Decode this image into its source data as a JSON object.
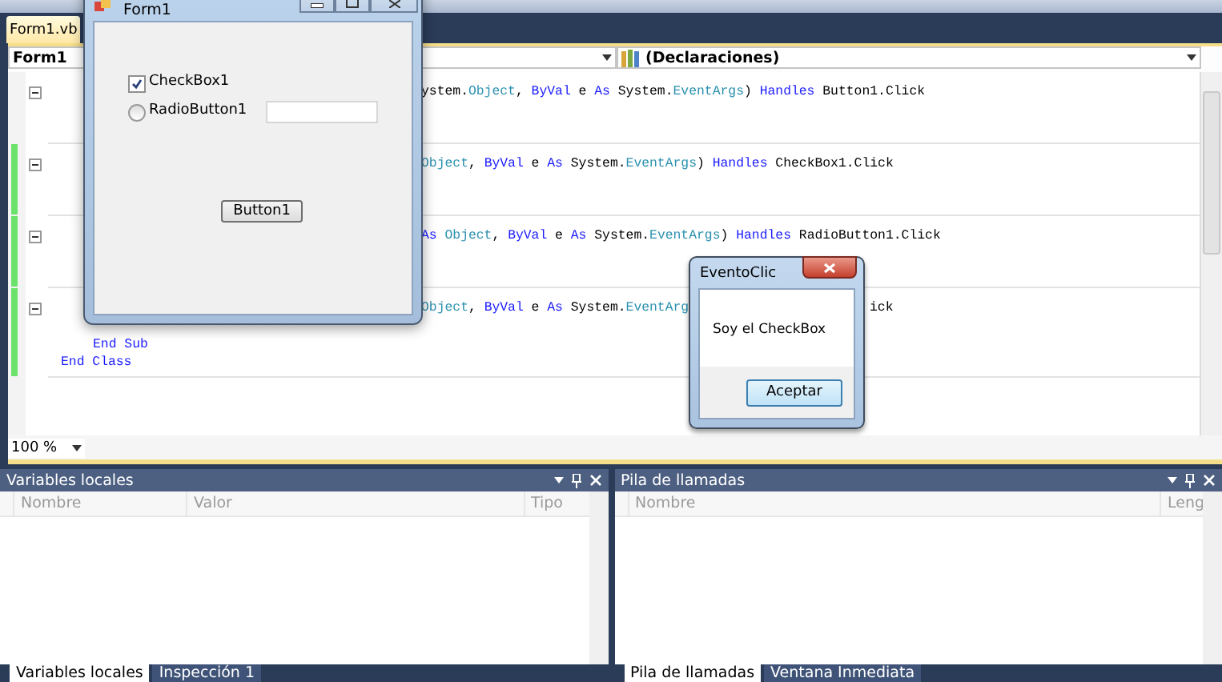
{
  "ide": {
    "document_tabs": [
      {
        "label": "Form1.vb",
        "selected": true
      }
    ],
    "class_combo": "Form1",
    "member_combo": "(Declaraciones)",
    "code_blocks": [
      {
        "modified": false,
        "signature": [
          [
            {
              "text": "ystem.",
              "kind": "plain"
            },
            {
              "text": "Object",
              "kind": "type"
            },
            {
              "text": ", ",
              "kind": "plain"
            },
            {
              "text": "ByVal",
              "kind": "keyword"
            },
            {
              "text": " e ",
              "kind": "plain"
            },
            {
              "text": "As",
              "kind": "keyword"
            },
            {
              "text": " System.",
              "kind": "plain"
            },
            {
              "text": "EventArgs",
              "kind": "type"
            },
            {
              "text": ") ",
              "kind": "plain"
            },
            {
              "text": "Handles",
              "kind": "keyword"
            },
            {
              "text": " Button1.Click",
              "kind": "plain"
            }
          ]
        ]
      },
      {
        "modified": true,
        "signature": [
          [
            {
              "text": "Object",
              "kind": "type"
            },
            {
              "text": ", ",
              "kind": "plain"
            },
            {
              "text": "ByVal",
              "kind": "keyword"
            },
            {
              "text": " e ",
              "kind": "plain"
            },
            {
              "text": "As",
              "kind": "keyword"
            },
            {
              "text": " System.",
              "kind": "plain"
            },
            {
              "text": "EventArgs",
              "kind": "type"
            },
            {
              "text": ") ",
              "kind": "plain"
            },
            {
              "text": "Handles",
              "kind": "keyword"
            },
            {
              "text": " CheckBox1.Click",
              "kind": "plain"
            }
          ]
        ]
      },
      {
        "modified": true,
        "signature": [
          [
            {
              "text": "As",
              "kind": "keyword"
            },
            {
              "text": " Object",
              "kind": "type"
            },
            {
              "text": ", ",
              "kind": "plain"
            },
            {
              "text": "ByVal",
              "kind": "keyword"
            },
            {
              "text": " e ",
              "kind": "plain"
            },
            {
              "text": "As",
              "kind": "keyword"
            },
            {
              "text": " System.",
              "kind": "plain"
            },
            {
              "text": "EventArgs",
              "kind": "type"
            },
            {
              "text": ") ",
              "kind": "plain"
            },
            {
              "text": "Handles",
              "kind": "keyword"
            },
            {
              "text": " RadioButton1.Click",
              "kind": "plain"
            }
          ]
        ]
      },
      {
        "modified": true,
        "signature": [
          [
            {
              "text": "Object",
              "kind": "type"
            },
            {
              "text": ", ",
              "kind": "plain"
            },
            {
              "text": "ByVal",
              "kind": "keyword"
            },
            {
              "text": " e ",
              "kind": "plain"
            },
            {
              "text": "As",
              "kind": "keyword"
            },
            {
              "text": " System.",
              "kind": "plain"
            },
            {
              "text": "EventArg",
              "kind": "type"
            }
          ],
          [
            {
              "text": "ick",
              "kind": "plain"
            }
          ]
        ],
        "trailing": [
          {
            "text": "End Sub",
            "kind": "keyword"
          }
        ]
      }
    ],
    "code_end": {
      "text": "End Class",
      "kind": "keyword"
    },
    "zoom": "100 %"
  },
  "panels": [
    {
      "title": "Variables locales",
      "columns": [
        "Nombre",
        "Valor",
        "Tipo"
      ],
      "tabs": [
        {
          "label": "Variables locales",
          "selected": true
        },
        {
          "label": "Inspección 1",
          "selected": false
        }
      ]
    },
    {
      "title": "Pila de llamadas",
      "columns": [
        "Nombre",
        "Leng"
      ],
      "tabs": [
        {
          "label": "Pila de llamadas",
          "selected": true
        },
        {
          "label": "Ventana Inmediata",
          "selected": false
        }
      ]
    }
  ],
  "form_window": {
    "title": "Form1",
    "checkbox": {
      "label": "CheckBox1",
      "checked": true
    },
    "radio": {
      "label": "RadioButton1",
      "selected": false
    },
    "button": "Button1"
  },
  "message_box": {
    "title": "EventoClic",
    "message": "Soy el CheckBox",
    "button": "Aceptar"
  }
}
